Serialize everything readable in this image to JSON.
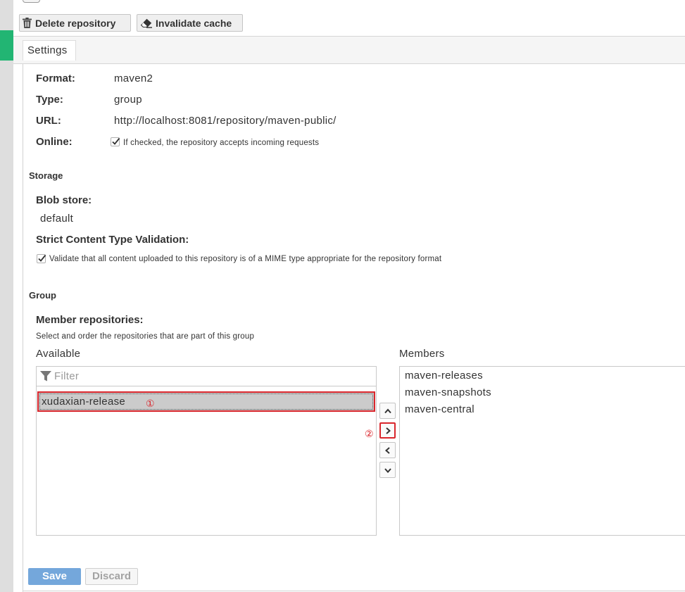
{
  "toolbar": {
    "delete_label": "Delete repository",
    "invalidate_label": "Invalidate cache"
  },
  "tabs": [
    {
      "label": "Settings",
      "active": true
    }
  ],
  "fields": {
    "format": {
      "label": "Format:",
      "value": "maven2"
    },
    "type": {
      "label": "Type:",
      "value": "group"
    },
    "url": {
      "label": "URL:",
      "value": "http://localhost:8081/repository/maven-public/"
    },
    "online": {
      "label": "Online:",
      "checked": true,
      "help": "If checked, the repository accepts incoming requests"
    }
  },
  "storage": {
    "heading": "Storage",
    "blob_label": "Blob store:",
    "blob_value": "default",
    "strict_label": "Strict Content Type Validation:",
    "strict_checked": true,
    "strict_help": "Validate that all content uploaded to this repository is of a MIME type appropriate for the repository format"
  },
  "group": {
    "heading": "Group",
    "members_label": "Member repositories:",
    "members_help": "Select and order the repositories that are part of this group",
    "available_label": "Available",
    "members_list_label": "Members",
    "filter_placeholder": "Filter",
    "available": [
      {
        "name": "xudaxian-release",
        "selected": true
      }
    ],
    "members": [
      "maven-releases",
      "maven-snapshots",
      "maven-central"
    ]
  },
  "annotations": {
    "step1": "①",
    "step2": "②"
  },
  "buttons": {
    "save": "Save",
    "discard": "Discard"
  },
  "icons": {
    "delete": "trash-icon",
    "invalidate": "eraser-icon",
    "filter": "filter-icon",
    "move_up": "chevron-up-icon",
    "add": "chevron-right-icon",
    "remove": "chevron-left-icon",
    "move_down": "chevron-down-icon"
  },
  "colors": {
    "brand": "#22b573",
    "accent": "#74a7db",
    "annotation": "#d9262c"
  }
}
